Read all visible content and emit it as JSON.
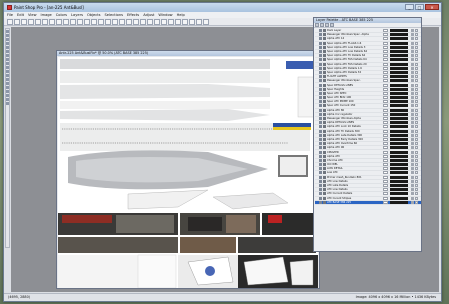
{
  "app": {
    "title": "Paint Shop Pro - [an-225 Ant&Busl]"
  },
  "window_controls": {
    "minimize": "_",
    "maximize": "□",
    "close": "✕"
  },
  "menu": [
    "File",
    "Edit",
    "View",
    "Image",
    "Colors",
    "Layers",
    "Objects",
    "Selections",
    "Effects",
    "Adjust",
    "Window",
    "Help"
  ],
  "image_window": {
    "title": "Antr-225 Ant&BuslFix* @ 50.0% (ATC BASE 385 225)"
  },
  "layer_palette": {
    "title": "Layer Palette - ATC BASE 385 225",
    "layers": [
      "Dark Layer",
      "Passenger Windows Spec. Alpha",
      "Alpha ATC 14",
      "Spec Alpha ATC FLAGS 1.6",
      "Spec Alpha ATC Low Details 3",
      "Spec Alpha ATC Low Details 64",
      "Spec Alpha ATC TC Details 64",
      "Spec Alpha ATC FAS Details 64",
      "Spec Alpha ATC FAS Details 20",
      "Spec Alpha ATC Details 1.6",
      "Spec Alpha ATC Details 32",
      "FLIGHT ALERTS",
      "Passenger Windows Spec.",
      "Spec DETAILS LINES",
      "Spec Heights",
      "Spec ATC SPEC",
      "Spec ATC Blitz 100",
      "Spec ATC PRIME 100",
      "Spec ATC Current 150",
      "Alpha ATC 80",
      "Alpha Cnr regulator",
      "Passenger Windows Alpha",
      "Alpha DETAILS LINES",
      "Alpha ATC Lock 10 Details",
      "Alpha ATC TC Details 300",
      "Alpha ATC Late Details 300",
      "Alpha ATC Early Details 300",
      "Alpha ATC Overtime 66",
      "Alpha ATC 96",
      "CMAVIER",
      "Alpha ATC",
      "Chrome ATC",
      "Old WEL",
      "LOW DETAIL",
      "Low ATC",
      "Primer mesh_Rundwin 801",
      "ATC Low Details",
      "ATC Late Details",
      "ATC Low Details",
      "ATC Current Details",
      "ATC Curent Stripes",
      "ATC BASE 386 225"
    ],
    "selected_index": 41
  },
  "status": {
    "left": "(4695, 2880)",
    "right": "Image: 4096 x 4096 x 16 Million • 1436 KBytes"
  }
}
